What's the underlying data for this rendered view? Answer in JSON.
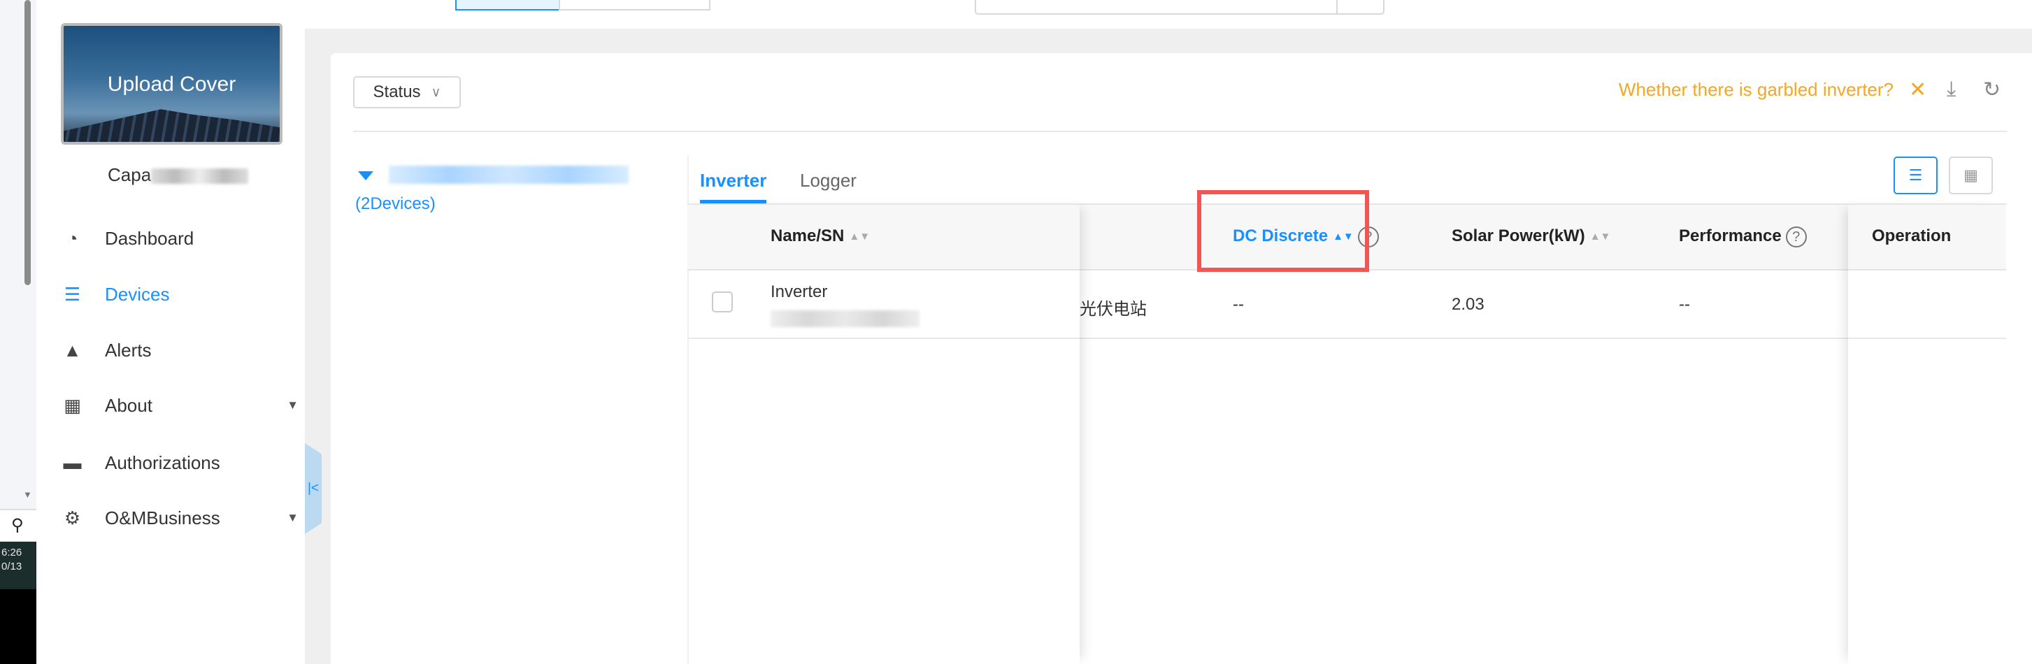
{
  "taskbar": {
    "time": "6:26",
    "date": "0/13"
  },
  "sidebar": {
    "cover_label": "Upload Cover",
    "plant_name": "Capa",
    "items": [
      {
        "label": "Dashboard",
        "icon": "dashboard-icon"
      },
      {
        "label": "Devices",
        "icon": "devices-icon",
        "active": true
      },
      {
        "label": "Alerts",
        "icon": "alert-icon"
      },
      {
        "label": "About",
        "icon": "solar-panel-icon",
        "has_submenu": true
      },
      {
        "label": "Authorizations",
        "icon": "briefcase-key-icon"
      },
      {
        "label": "O&MBusiness",
        "icon": "gear-wrench-icon",
        "has_submenu": true
      }
    ]
  },
  "toolbar": {
    "status_label": "Status",
    "garbled_link": "Whether there is garbled inverter?"
  },
  "tree": {
    "device_count": "(2Devices)"
  },
  "tabs": [
    "Inverter",
    "Logger"
  ],
  "table": {
    "columns": [
      "Name/SN",
      "DC Discrete",
      "Solar Power(kW)",
      "Performance",
      "Operation"
    ],
    "rows": [
      {
        "name": "Inverter",
        "station": "光伏电站",
        "dc_discrete": "--",
        "solar_power": "2.03",
        "performance": "--",
        "operation": ""
      }
    ]
  },
  "colors": {
    "accent": "#1890ff",
    "warning": "#f5a623",
    "highlight": "#f45454"
  }
}
